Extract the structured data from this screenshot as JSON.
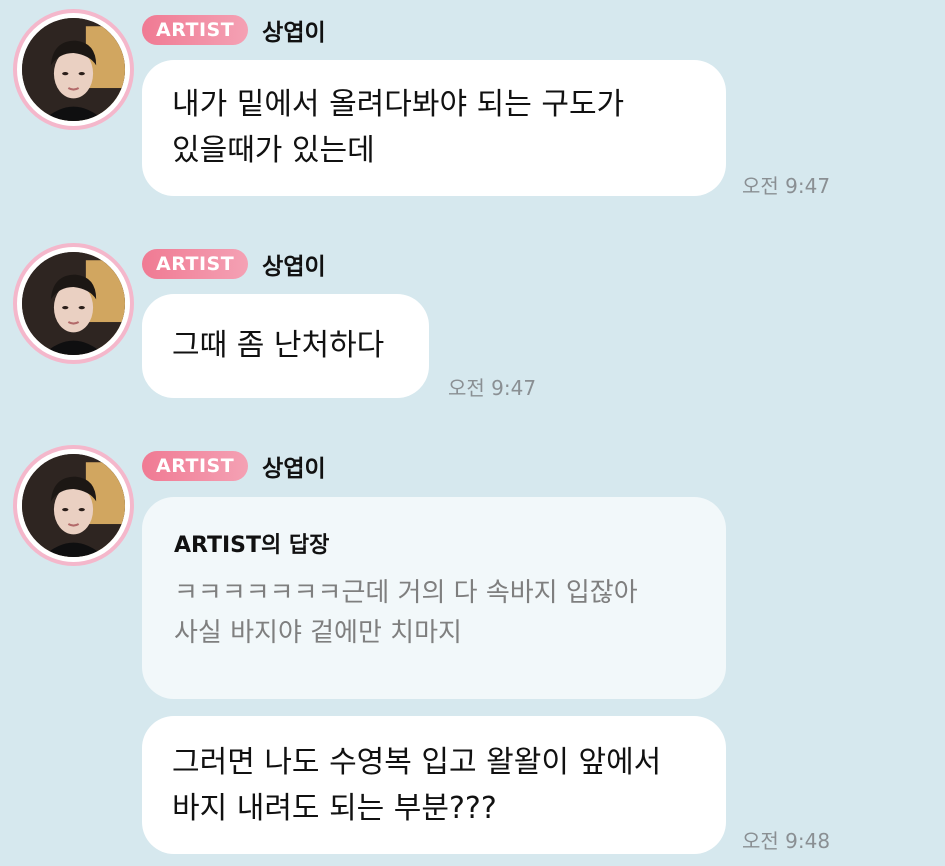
{
  "colors": {
    "background": "#d6e8ee",
    "bubble": "#ffffff",
    "reply_bubble": "#f2f8fa",
    "artist_badge": "#f07a93",
    "avatar_ring": "#f4b7cb",
    "timestamp": "#8a8f93",
    "reply_text": "#7f7f7f"
  },
  "messages": [
    {
      "badge": "ARTIST",
      "sender": "상엽이",
      "avatar_icon": "artist-profile-photo",
      "lines": [
        "내가 밑에서 올려다봐야 되는 구도가",
        "있을때가 있는데"
      ],
      "time": "오전 9:47"
    },
    {
      "badge": "ARTIST",
      "sender": "상엽이",
      "avatar_icon": "artist-profile-photo",
      "lines": [
        "그때 좀 난처하다"
      ],
      "time": "오전 9:47"
    },
    {
      "badge": "ARTIST",
      "sender": "상엽이",
      "avatar_icon": "artist-profile-photo",
      "reply": {
        "title": "ARTIST의 답장",
        "lines": [
          "ㅋㅋㅋㅋㅋㅋㅋ근데 거의 다 속바지 입잖아",
          "사실 바지야 겉에만 치마지"
        ]
      },
      "lines": [
        "그러면 나도 수영복 입고 왈왈이 앞에서",
        "바지 내려도 되는 부분???"
      ],
      "time": "오전 9:48"
    }
  ]
}
